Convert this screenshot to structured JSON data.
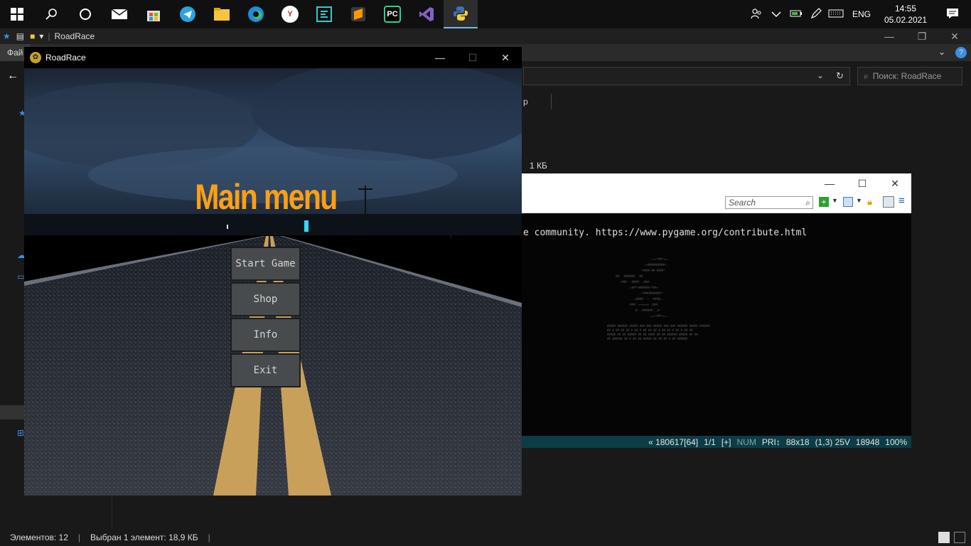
{
  "taskbar": {
    "apps": [
      "start-icon",
      "search-icon",
      "cortana-icon",
      "mail-icon",
      "store-icon",
      "telegram-icon",
      "file-explorer-icon",
      "edge-icon",
      "yandex-icon",
      "editor-icon",
      "sublime-icon",
      "pycharm-icon",
      "visual-studio-icon",
      "python-icon"
    ],
    "pycharm_label": "PC",
    "yandex_label": "Y",
    "lang": "ENG",
    "time": "14:55",
    "date": "05.02.2021"
  },
  "explorer": {
    "title": "RoadRace",
    "file_tab": "Фай",
    "search_placeholder": "Поиск: RoadRace",
    "column_fragment": "р",
    "size_text": "1 КБ",
    "status_items": "Элементов: 12",
    "status_selected": "Выбран 1 элемент: 18,9 КБ"
  },
  "viewer": {
    "search_placeholder": "Search",
    "line": "e community. https://www.pygame.org/contribute.html",
    "status": {
      "pos": "« 180617[64]",
      "page": "1/1",
      "plus": "[+]",
      "num": "NUM",
      "pri": "PRI↕",
      "size": "88x18",
      "cursor": "(1,3) 25V",
      "bytes": "18948",
      "zoom": "100%"
    }
  },
  "game": {
    "window_title": "RoadRace",
    "menu_title": "Main menu",
    "buttons": {
      "start": "Start Game",
      "shop": "Shop",
      "info": "Info",
      "exit": "Exit"
    }
  },
  "colors": {
    "menu_title": "#ff9f14",
    "button_bg": "#484b4d",
    "taskbar": "#101010"
  }
}
